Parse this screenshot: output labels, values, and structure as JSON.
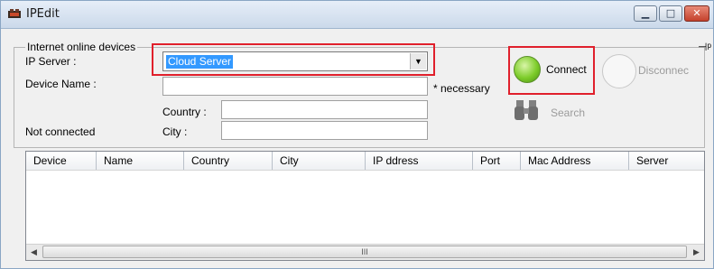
{
  "window": {
    "title": "IPEdit"
  },
  "group": {
    "label": "Internet online devices",
    "ip_server_label": "IP Server :",
    "ip_server_value": "Cloud Server",
    "device_name_label": "Device Name :",
    "device_name_value": "",
    "necessary_note": "* necessary",
    "country_label": "Country :",
    "country_value": "",
    "city_label": "City :",
    "city_value": "",
    "status_text": "Not connected"
  },
  "buttons": {
    "connect": "Connect",
    "disconnect": "Disconnec",
    "search": "Search"
  },
  "table": {
    "columns": [
      "Device",
      "Name",
      "Country",
      "City",
      "IP ddress",
      "Port",
      "Mac Address",
      "Server"
    ],
    "rows": []
  },
  "scrollbar": {
    "grip": "III"
  },
  "icons": {
    "app": "ipedit-app-icon",
    "connect": "green-orb-icon",
    "disconnect": "grey-orb-icon",
    "search": "binoculars-icon",
    "pin": "pin-icon"
  },
  "colors": {
    "highlight": "#e0202c",
    "selection": "#3399ff",
    "connect_green": "#7dcc2a"
  }
}
